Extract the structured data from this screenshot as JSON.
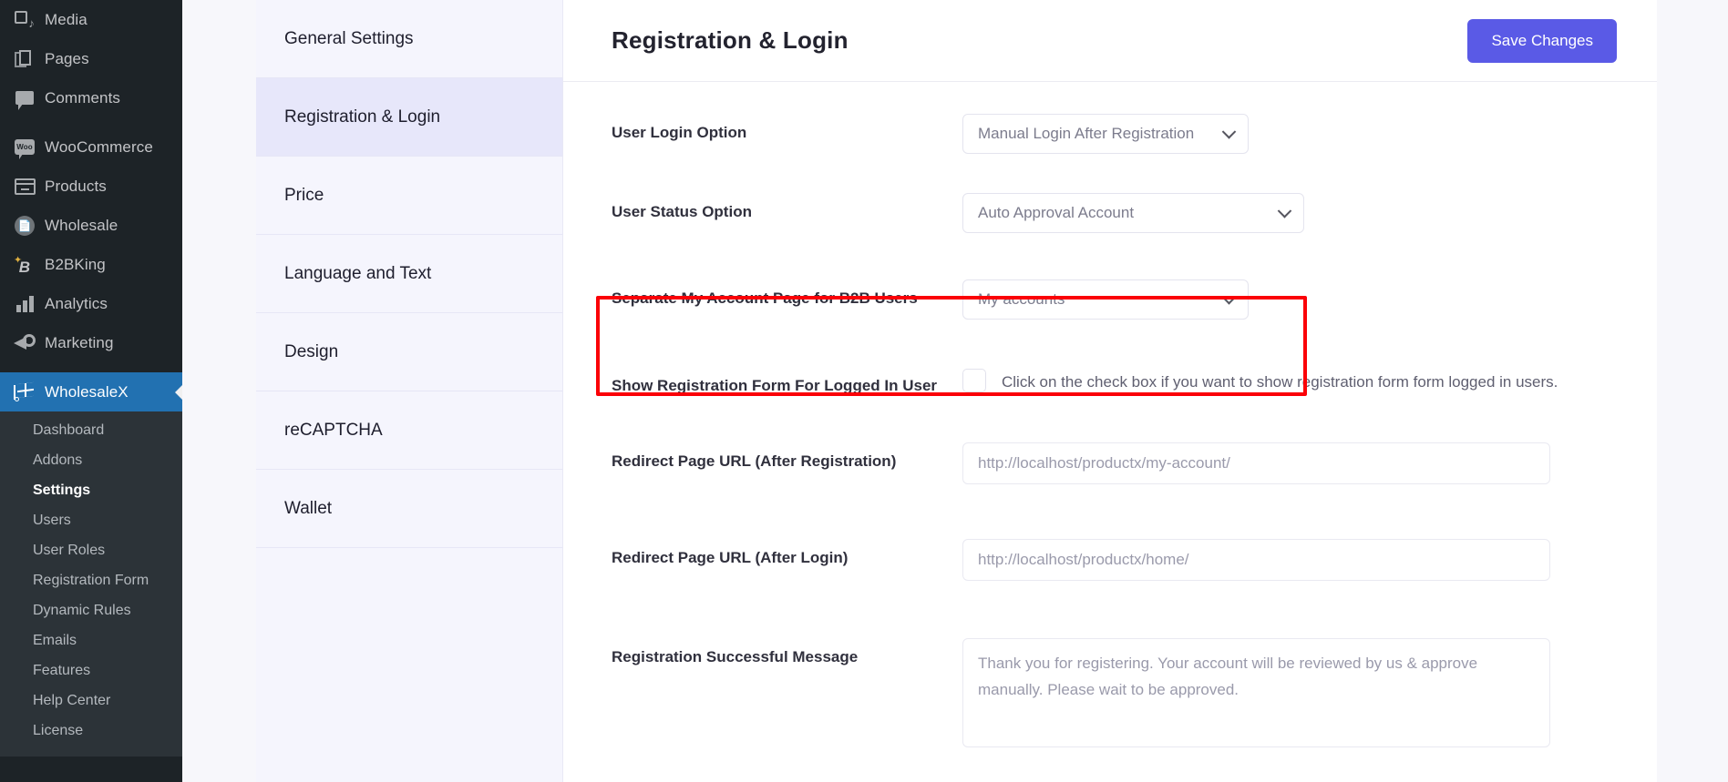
{
  "wp_sidebar": {
    "items": [
      {
        "label": "Media",
        "icon": "media-icon"
      },
      {
        "label": "Pages",
        "icon": "pages-icon"
      },
      {
        "label": "Comments",
        "icon": "comments-icon"
      },
      {
        "label": "WooCommerce",
        "icon": "woocommerce-icon"
      },
      {
        "label": "Products",
        "icon": "products-icon"
      },
      {
        "label": "Wholesale",
        "icon": "wholesale-icon"
      },
      {
        "label": "B2BKing",
        "icon": "b2bking-icon"
      },
      {
        "label": "Analytics",
        "icon": "analytics-icon"
      },
      {
        "label": "Marketing",
        "icon": "marketing-icon"
      },
      {
        "label": "WholesaleX",
        "icon": "wholesalex-icon"
      }
    ],
    "submenu": [
      {
        "label": "Dashboard"
      },
      {
        "label": "Addons"
      },
      {
        "label": "Settings"
      },
      {
        "label": "Users"
      },
      {
        "label": "User Roles"
      },
      {
        "label": "Registration Form"
      },
      {
        "label": "Dynamic Rules"
      },
      {
        "label": "Emails"
      },
      {
        "label": "Features"
      },
      {
        "label": "Help Center"
      },
      {
        "label": "License"
      }
    ]
  },
  "settings_tabs": [
    {
      "label": "General Settings"
    },
    {
      "label": "Registration & Login"
    },
    {
      "label": "Price"
    },
    {
      "label": "Language and Text"
    },
    {
      "label": "Design"
    },
    {
      "label": "reCAPTCHA"
    },
    {
      "label": "Wallet"
    }
  ],
  "header": {
    "title": "Registration & Login",
    "save_label": "Save Changes"
  },
  "form": {
    "user_login_option": {
      "label": "User Login Option",
      "value": "Manual Login After Registration"
    },
    "user_status_option": {
      "label": "User Status Option",
      "value": "Auto Approval Account"
    },
    "separate_my_account": {
      "label": "Separate My Account Page for B2B Users",
      "value": "My accounts"
    },
    "show_registration_form": {
      "label": "Show Registration Form For Logged In User",
      "description": "Click on the check box if you want to show registration form form logged in users."
    },
    "redirect_after_registration": {
      "label": "Redirect Page URL (After Registration)",
      "placeholder": "http://localhost/productx/my-account/"
    },
    "redirect_after_login": {
      "label": "Redirect Page URL (After Login)",
      "placeholder": "http://localhost/productx/home/"
    },
    "registration_successful_message": {
      "label": "Registration Successful Message",
      "placeholder": "Thank you for registering. Your account will be reviewed by us & approve manually. Please wait to be approved."
    }
  },
  "colors": {
    "accent": "#5a5ae6",
    "wp_active": "#2271b1",
    "highlight": "#fb0007"
  }
}
